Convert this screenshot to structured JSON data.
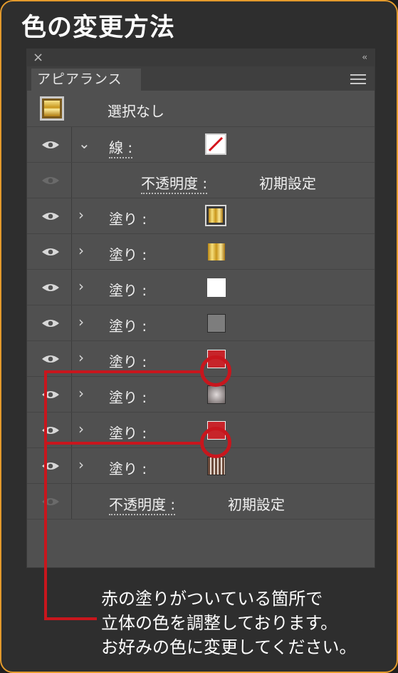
{
  "heading": "色の変更方法",
  "panel": {
    "close_glyph": "×",
    "collapse_glyph": "‹‹",
    "tab_label": "アピアランス",
    "header_label": "選択なし",
    "rows": [
      {
        "kind": "stroke",
        "label": "線 :",
        "swatch": "none-slash"
      },
      {
        "kind": "opacity",
        "label": "不透明度 :",
        "value": "初期設定"
      },
      {
        "kind": "fill",
        "label": "塗り :",
        "swatch": "gold-framed"
      },
      {
        "kind": "fill",
        "label": "塗り :",
        "swatch": "gold"
      },
      {
        "kind": "fill",
        "label": "塗り :",
        "swatch": "white"
      },
      {
        "kind": "fill",
        "label": "塗り :",
        "swatch": "gray"
      },
      {
        "kind": "fill",
        "label": "塗り :",
        "swatch": "red"
      },
      {
        "kind": "fill",
        "label": "塗り :",
        "swatch": "radial-gray"
      },
      {
        "kind": "fill",
        "label": "塗り :",
        "swatch": "red"
      },
      {
        "kind": "fill",
        "label": "塗り :",
        "swatch": "stripes"
      }
    ],
    "footer_opacity": {
      "label": "不透明度 :",
      "value": "初期設定"
    }
  },
  "caption_lines": [
    "赤の塗りがついている箇所で",
    "立体の色を調整しております。",
    "お好みの色に変更してください。"
  ],
  "colors": {
    "accent_border": "#e39a2c",
    "callout_red": "#c8161d",
    "panel_bg": "#505050"
  }
}
